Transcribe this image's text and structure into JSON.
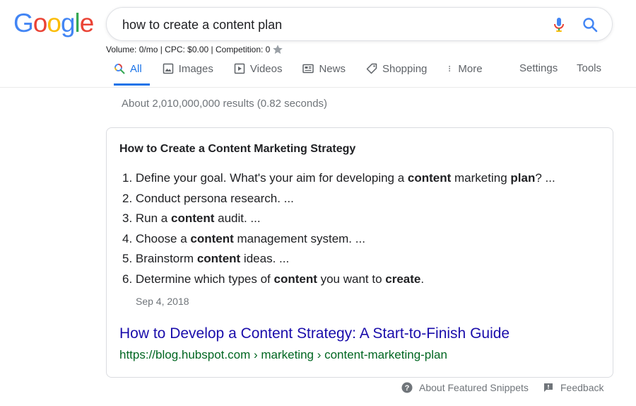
{
  "logo": {
    "letters": [
      "G",
      "o",
      "o",
      "g",
      "l",
      "e"
    ],
    "colors": [
      "#4285f4",
      "#ea4335",
      "#fbbc05",
      "#4285f4",
      "#34a853",
      "#ea4335"
    ]
  },
  "search": {
    "query": "how to create a content plan",
    "mic_icon": "mic-icon",
    "search_icon": "search-icon"
  },
  "keyword_stats": {
    "text": "Volume: 0/mo | CPC: $0.00 | Competition: 0",
    "icon": "star-icon"
  },
  "tabs": [
    {
      "label": "All",
      "icon": "search-icon",
      "active": true
    },
    {
      "label": "Images",
      "icon": "image-icon",
      "active": false
    },
    {
      "label": "Videos",
      "icon": "video-icon",
      "active": false
    },
    {
      "label": "News",
      "icon": "news-icon",
      "active": false
    },
    {
      "label": "Shopping",
      "icon": "tag-icon",
      "active": false
    },
    {
      "label": "More",
      "icon": "more-vertical-icon",
      "active": false
    }
  ],
  "tabs_right": {
    "settings": "Settings",
    "tools": "Tools"
  },
  "result_stats": "About 2,010,000,000 results (0.82 seconds)",
  "snippet": {
    "title": "How to Create a Content Marketing Strategy",
    "items": [
      [
        {
          "t": "1. Define your goal. What's your aim for developing a "
        },
        {
          "t": "content",
          "b": true
        },
        {
          "t": " marketing "
        },
        {
          "t": "plan",
          "b": true
        },
        {
          "t": "? ..."
        }
      ],
      [
        {
          "t": "2. Conduct persona research. ..."
        }
      ],
      [
        {
          "t": "3. Run a "
        },
        {
          "t": "content",
          "b": true
        },
        {
          "t": " audit. ..."
        }
      ],
      [
        {
          "t": "4. Choose a "
        },
        {
          "t": "content",
          "b": true
        },
        {
          "t": " management system. ..."
        }
      ],
      [
        {
          "t": "5. Brainstorm "
        },
        {
          "t": "content",
          "b": true
        },
        {
          "t": " ideas. ..."
        }
      ],
      [
        {
          "t": "6. Determine which types of "
        },
        {
          "t": "content",
          "b": true
        },
        {
          "t": " you want to "
        },
        {
          "t": "create",
          "b": true
        },
        {
          "t": "."
        }
      ]
    ],
    "date": "Sep 4, 2018",
    "result_title": "How to Develop a Content Strategy: A Start-to-Finish Guide",
    "result_url": "https://blog.hubspot.com › marketing › content-marketing-plan"
  },
  "footer": {
    "about": "About Featured Snippets",
    "about_icon": "help-icon",
    "feedback": "Feedback",
    "feedback_icon": "feedback-icon"
  },
  "colors": {
    "accent": "#1a73e8",
    "link": "#1a0dab",
    "url": "#006621",
    "muted": "#70757a"
  }
}
